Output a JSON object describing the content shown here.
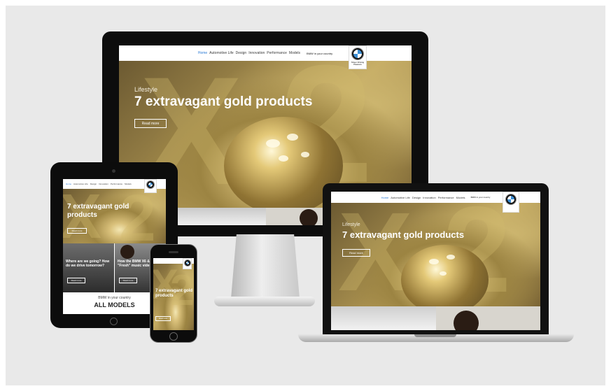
{
  "nav": {
    "items": [
      "Home",
      "Automotive Life",
      "Design",
      "Innovation",
      "Performance",
      "Models"
    ],
    "country": "BMW in your country"
  },
  "hero": {
    "category": "Lifestyle",
    "title": "7 extravagant gold products",
    "tablet_title": "7 extravagant gold products",
    "button": "Read more"
  },
  "tablet_cards": [
    {
      "title": "Where are we going? How do we drive tomorrow?",
      "button": "Read more"
    },
    {
      "title": "How the BMW X6 & the \"Fresh\" music video",
      "button": "Read more"
    }
  ],
  "models_section": {
    "country": "BMW in your country",
    "heading": "ALL MODELS"
  },
  "phone": {
    "title": "7 extravagant gold products",
    "button": "Read more"
  },
  "logo_caption": "Sheer Driving Pleasure",
  "colors": {
    "background": "#e9e9e9",
    "gold": "#a38b4c",
    "link": "#2b7bd6",
    "device": "#0d0d0d"
  }
}
